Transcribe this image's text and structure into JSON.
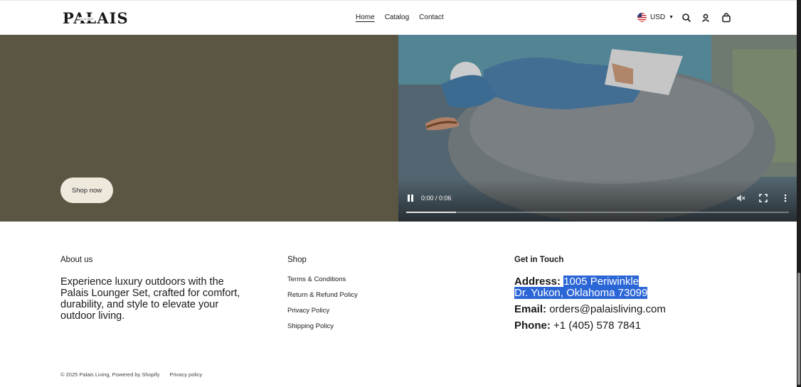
{
  "header": {
    "logo_text": "PALAIS",
    "logo_sub": "LIVING",
    "nav": [
      {
        "label": "Home"
      },
      {
        "label": "Catalog"
      },
      {
        "label": "Contact"
      }
    ],
    "currency": "USD",
    "icons": [
      "flag-us-icon",
      "chevron-down-icon",
      "search-icon",
      "account-icon",
      "cart-icon"
    ]
  },
  "hero": {
    "button_label": "Shop now",
    "video": {
      "time": "0:00 / 0:06",
      "progress": 0.13,
      "icons": [
        "pause-icon",
        "mute-icon",
        "fullscreen-icon",
        "more-options-icon"
      ]
    }
  },
  "footer": {
    "about": {
      "title": "About us",
      "text": "Experience luxury outdoors with the Palais Lounger Set, crafted for comfort, durability, and style to elevate your outdoor living."
    },
    "shop": {
      "title": "Shop",
      "links": [
        {
          "label": "Terms & Conditions"
        },
        {
          "label": "Return & Refund Policy"
        },
        {
          "label": "Privacy Policy"
        },
        {
          "label": "Shipping Policy"
        }
      ]
    },
    "touch": {
      "title": "Get in Touch",
      "address_label": "Address:",
      "address_line1": "1005 Periwinkle",
      "address_line2": "Dr. Yukon, Oklahoma 73099",
      "email_label": "Email:",
      "email": "orders@palaisliving.com",
      "phone_label": "Phone:",
      "phone": "+1 (405) 578 7841"
    },
    "copyright": "© 2025 Palais Living, Powered by Shopify",
    "privacy_link": "Privacy policy"
  },
  "colors": {
    "hero_bg": "#5a5643",
    "button_bg": "#efe9dd",
    "selection": "#2b66d6"
  }
}
